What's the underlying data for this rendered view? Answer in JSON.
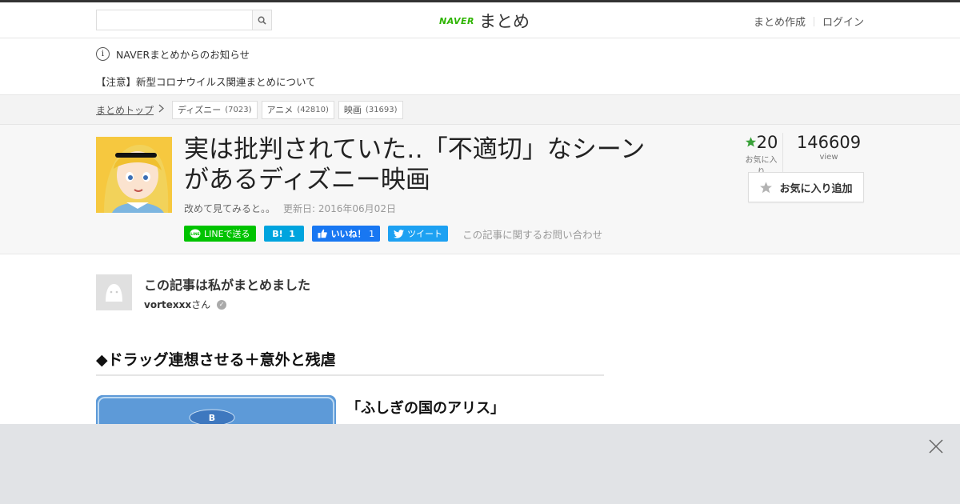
{
  "header": {
    "search_placeholder": "",
    "logo_brand": "NAVER",
    "logo_name": "まとめ",
    "nav": [
      "まとめ作成",
      "ログイン"
    ]
  },
  "notice": {
    "title": "NAVERまとめからのお知らせ",
    "item": "【注意】新型コロナウイルス関連まとめについて"
  },
  "breadcrumb": {
    "top_label": "まとめトップ",
    "tags": [
      {
        "label": "ディズニー",
        "count": "(7023)"
      },
      {
        "label": "アニメ",
        "count": "(42810)"
      },
      {
        "label": "映画",
        "count": "(31693)"
      }
    ]
  },
  "article": {
    "title": "実は批判されていた‥「不適切」なシーンがあるディズニー映画",
    "description": "改めて見てみると。。",
    "updated": "更新日: 2016年06月02日",
    "favorites_count": "20",
    "favorites_label": "お気に入り",
    "views_count": "146609",
    "views_label": "view",
    "fav_button": "お気に入り追加",
    "inquiry": "この記事に関するお問い合わせ"
  },
  "share": {
    "line": "LINEで送る",
    "hatena_mark": "B!",
    "hatena_count": "1",
    "fb_label": "いいね！",
    "fb_count": "1",
    "tweet": "ツイート"
  },
  "author": {
    "heading": "この記事は私がまとめました",
    "name": "vortexxx",
    "suffix": "さん"
  },
  "content": {
    "section_title": "◆ドラッグ連想させる＋意外と残虐",
    "item_title": "「ふしぎの国のアリス」",
    "item_sub": ""
  },
  "colors": {
    "naver_green": "#2db400",
    "line": "#00c300",
    "hatena": "#00a4de",
    "facebook": "#1877f2",
    "twitter": "#1da1f2",
    "star": "#3aa13a"
  }
}
